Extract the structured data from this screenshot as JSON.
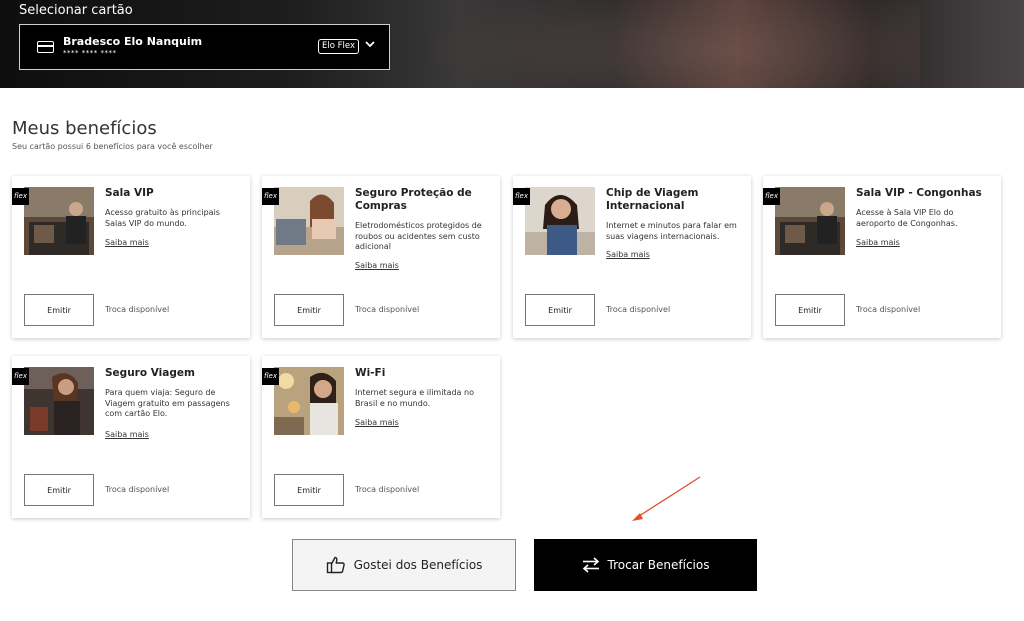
{
  "header": {
    "title": "Selecionar cartão",
    "card": {
      "name": "Bradesco Elo Nanquim",
      "number": "**** **** ****",
      "badge": "Elo Flex",
      "icon": "credit-card-icon",
      "toggle_icon": "chevron-down-icon"
    }
  },
  "main": {
    "title": "Meus benefícios",
    "subtitle": "Seu cartão possui 6 benefícios para você escolher"
  },
  "benefits": [
    {
      "tag": "flex",
      "title": "Sala VIP",
      "description": "Acesso gratuito às principais Salas VIP do mundo.",
      "link": "Saiba mais",
      "button": "Emitir",
      "status": "Troca disponível"
    },
    {
      "tag": "flex",
      "title": "Seguro Proteção de Compras",
      "description": "Eletrodomésticos protegidos de roubos ou acidentes sem custo adicional",
      "link": "Saiba mais",
      "button": "Emitir",
      "status": "Troca disponível"
    },
    {
      "tag": "flex",
      "title": "Chip de Viagem Internacional",
      "description": "Internet e minutos para falar em suas viagens internacionais.",
      "link": "Saiba mais",
      "button": "Emitir",
      "status": "Troca disponível"
    },
    {
      "tag": "flex",
      "title": "Sala VIP - Congonhas",
      "description": "Acesse à Sala VIP Elo do aeroporto de Congonhas.",
      "link": "Saiba mais",
      "button": "Emitir",
      "status": "Troca disponível"
    },
    {
      "tag": "flex",
      "title": "Seguro Viagem",
      "description": "Para quem viaja: Seguro de Viagem gratuito em passagens com cartão Elo.",
      "link": "Saiba mais",
      "button": "Emitir",
      "status": "Troca disponível"
    },
    {
      "tag": "flex",
      "title": "Wi-Fi",
      "description": "Internet segura e ilimitada no Brasil e no mundo.",
      "link": "Saiba mais",
      "button": "Emitir",
      "status": "Troca disponível"
    }
  ],
  "actions": {
    "like_label": "Gostei dos Benefícios",
    "like_icon": "thumbs-up-icon",
    "trade_label": "Trocar Benefícios",
    "trade_icon": "swap-arrows-icon"
  },
  "colors": {
    "accent_dark": "#000000",
    "annotation_arrow": "#e0502a"
  }
}
